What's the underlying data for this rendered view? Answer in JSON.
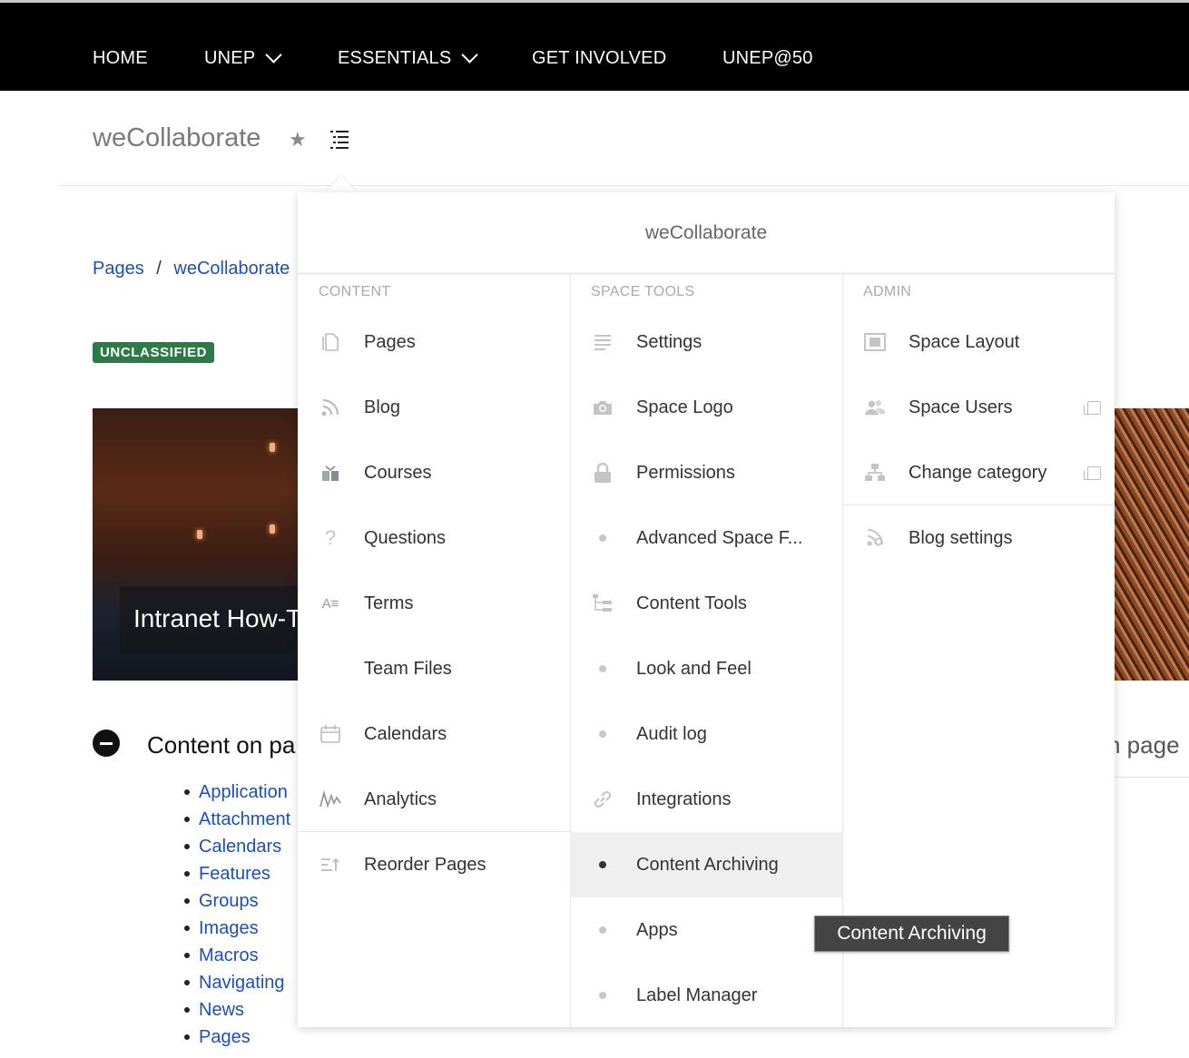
{
  "topnav": {
    "items": [
      {
        "label": "HOME",
        "has_dropdown": false
      },
      {
        "label": "UNEP",
        "has_dropdown": true
      },
      {
        "label": "ESSENTIALS",
        "has_dropdown": true
      },
      {
        "label": "GET INVOLVED",
        "has_dropdown": false
      },
      {
        "label": "UNEP@50",
        "has_dropdown": false
      }
    ]
  },
  "space": {
    "title": "weCollaborate",
    "star_icon": "star-icon",
    "menu_icon": "list-icon"
  },
  "breadcrumb": {
    "root": "Pages",
    "separator": "/",
    "current": "weCollaborate"
  },
  "badge": {
    "label": "UNCLASSIFIED",
    "color": "#2b7a48"
  },
  "hero": {
    "caption": "Intranet How-T"
  },
  "toc": {
    "title": "Content on pa",
    "right_fragment": "n page",
    "items": [
      "Application",
      "Attachment",
      "Calendars",
      "Features",
      "Groups",
      "Images",
      "Macros",
      "Navigating",
      "News",
      "Pages"
    ]
  },
  "dropdown": {
    "title": "weCollaborate",
    "columns": {
      "content": {
        "heading": "CONTENT",
        "items": [
          {
            "label": "Pages",
            "icon": "pages-icon"
          },
          {
            "label": "Blog",
            "icon": "rss-icon"
          },
          {
            "label": "Courses",
            "icon": "courses-icon"
          },
          {
            "label": "Questions",
            "icon": "question-icon"
          },
          {
            "label": "Terms",
            "icon": "terms-icon"
          },
          {
            "label": "Team Files",
            "icon": ""
          },
          {
            "label": "Calendars",
            "icon": "calendar-icon"
          },
          {
            "label": "Analytics",
            "icon": "analytics-icon"
          },
          {
            "label": "Reorder Pages",
            "icon": "reorder-icon"
          }
        ]
      },
      "space_tools": {
        "heading": "SPACE TOOLS",
        "items": [
          {
            "label": "Settings",
            "icon": "settings-list-icon"
          },
          {
            "label": "Space Logo",
            "icon": "camera-icon"
          },
          {
            "label": "Permissions",
            "icon": "lock-icon"
          },
          {
            "label": "Advanced Space F...",
            "icon": "dot-icon"
          },
          {
            "label": "Content Tools",
            "icon": "content-tools-icon"
          },
          {
            "label": "Look and Feel",
            "icon": "dot-icon"
          },
          {
            "label": "Audit log",
            "icon": "dot-icon"
          },
          {
            "label": "Integrations",
            "icon": "link-icon"
          },
          {
            "label": "Content Archiving",
            "icon": "dot-icon",
            "active": true
          },
          {
            "label": "Apps",
            "icon": "dot-icon"
          },
          {
            "label": "Label Manager",
            "icon": "dot-icon"
          }
        ]
      },
      "admin": {
        "heading": "ADMIN",
        "items": [
          {
            "label": "Space Layout",
            "icon": "layout-icon"
          },
          {
            "label": "Space Users",
            "icon": "users-icon",
            "external": true
          },
          {
            "label": "Change category",
            "icon": "hierarchy-icon",
            "external": true
          },
          {
            "label": "Blog settings",
            "icon": "blog-settings-icon"
          }
        ]
      }
    }
  },
  "tooltip": {
    "text": "Content Archiving"
  }
}
